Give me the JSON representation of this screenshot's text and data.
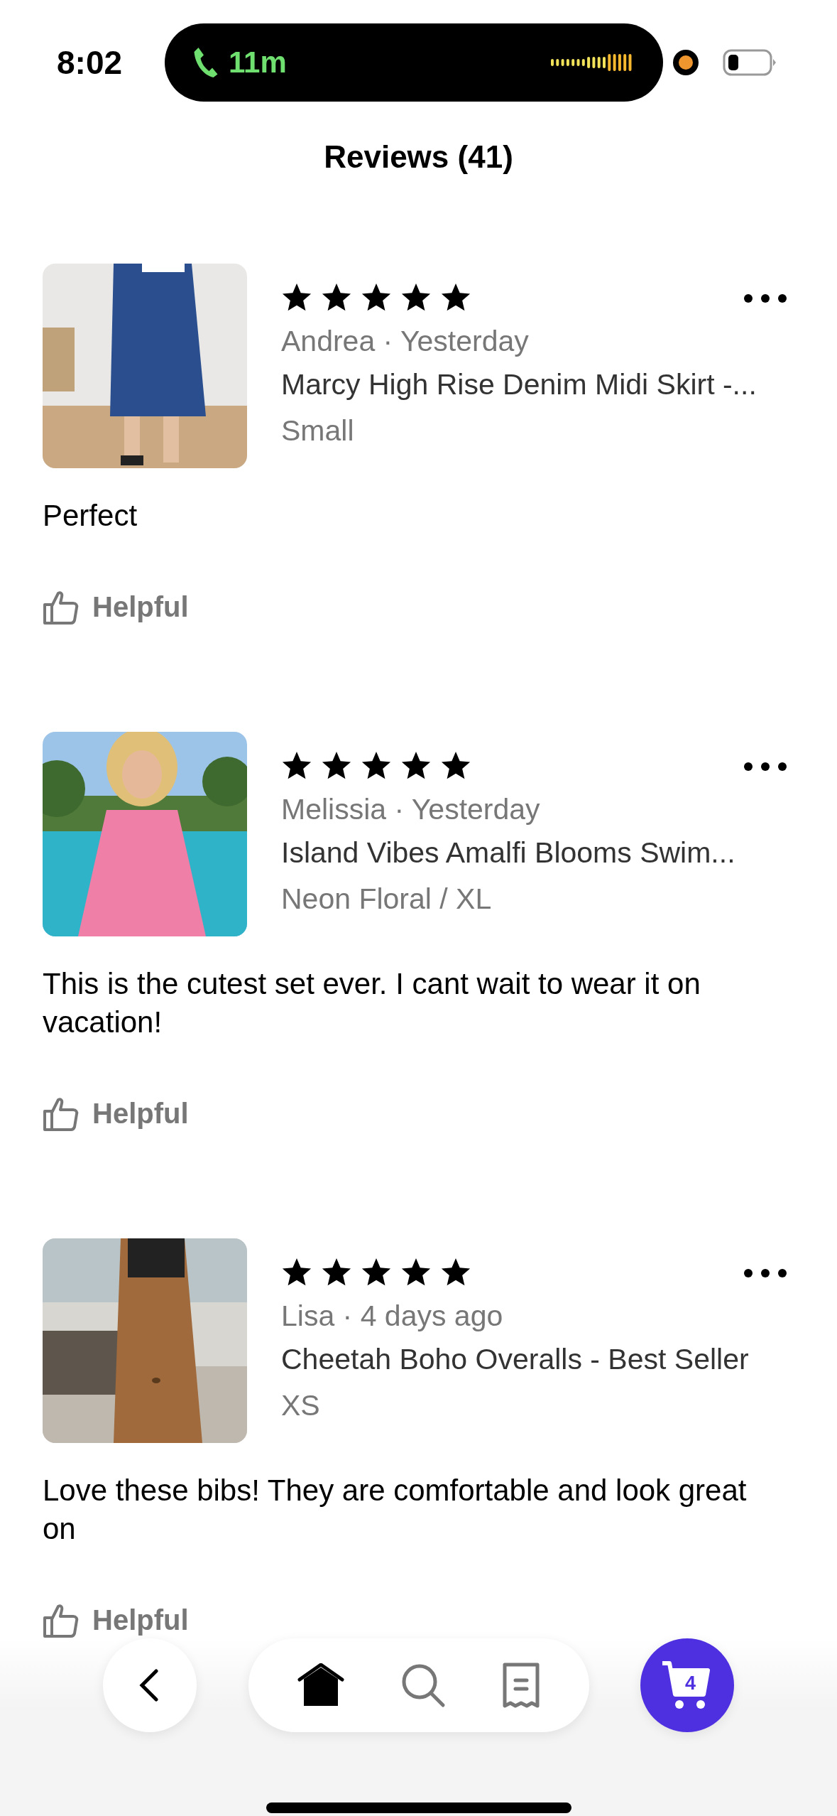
{
  "status_bar": {
    "time": "8:02",
    "call_duration": "11m"
  },
  "header": {
    "title": "Reviews (41)"
  },
  "reviews": [
    {
      "stars": 5,
      "author": "Andrea · Yesterday",
      "product": "Marcy High Rise Denim Midi Skirt -...",
      "variant": "Small",
      "text": "Perfect",
      "helpful": "Helpful"
    },
    {
      "stars": 5,
      "author": "Melissia · Yesterday",
      "product": "Island Vibes Amalfi Blooms Swim...",
      "variant": "Neon Floral / XL",
      "text": "This is the cutest set ever. I cant wait to wear it on vacation!",
      "helpful": "Helpful"
    },
    {
      "stars": 5,
      "author": "Lisa · 4 days ago",
      "product": "Cheetah Boho Overalls - Best Seller",
      "variant": "XS",
      "text": "Love these bibs! They are comfortable and look great on",
      "helpful": "Helpful"
    }
  ],
  "nav": {
    "tabs": [
      {
        "kind": "home",
        "selected": true
      },
      {
        "kind": "search",
        "selected": false
      },
      {
        "kind": "orders",
        "selected": false
      }
    ],
    "cart_count": "4"
  }
}
